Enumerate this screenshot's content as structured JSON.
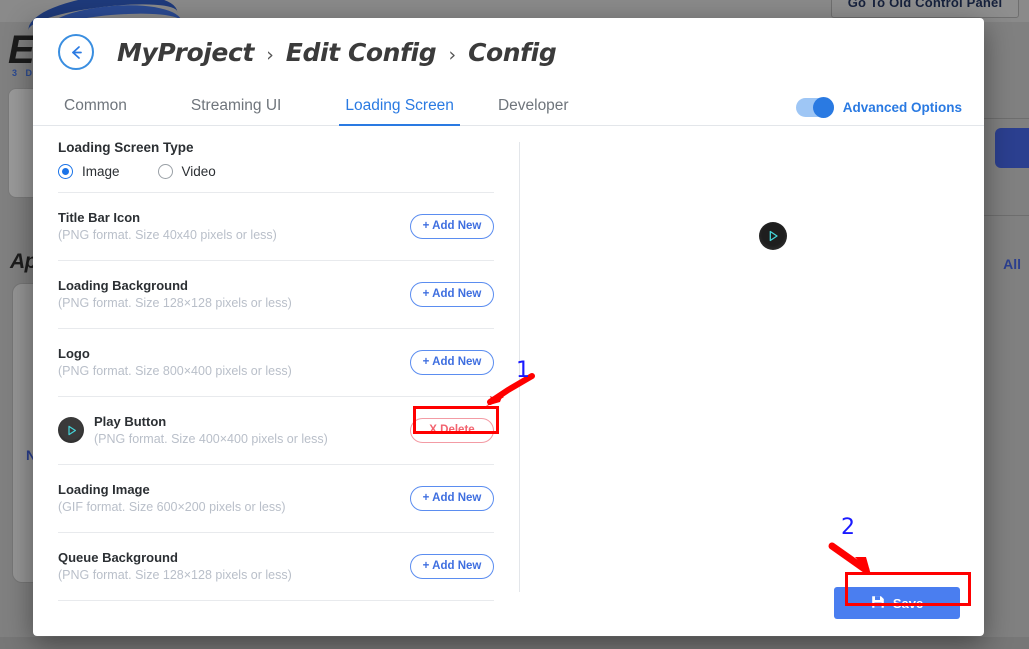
{
  "background": {
    "old_control_panel_button": "Go To Old Control Panel",
    "logo_text": "E",
    "logo_subtext": "3 D",
    "apps_label": "Ap",
    "n_label": "N",
    "all_link": "All"
  },
  "modal": {
    "back_icon": "arrow-left-icon",
    "breadcrumb": {
      "items": [
        "MyProject",
        "Edit Config",
        "Config"
      ],
      "separator": "›"
    },
    "tabs": [
      {
        "label": "Common",
        "active": false
      },
      {
        "label": "Streaming UI",
        "active": false
      },
      {
        "label": "Loading Screen",
        "active": true
      },
      {
        "label": "Developer",
        "active": false
      }
    ],
    "advanced_options": {
      "label": "Advanced Options",
      "enabled": true
    },
    "loading_screen_type": {
      "title": "Loading Screen Type",
      "options": [
        {
          "label": "Image",
          "selected": true
        },
        {
          "label": "Video",
          "selected": false
        }
      ]
    },
    "assets": [
      {
        "name": "Title Bar Icon",
        "hint": "(PNG format. Size 40x40 pixels or less)",
        "action": "+ Add New",
        "action_type": "add",
        "has_thumb": false
      },
      {
        "name": "Loading Background",
        "hint": "(PNG format. Size 128×128 pixels or less)",
        "action": "+ Add New",
        "action_type": "add",
        "has_thumb": false
      },
      {
        "name": "Logo",
        "hint": "(PNG format. Size 800×400 pixels or less)",
        "action": "+ Add New",
        "action_type": "add",
        "has_thumb": false
      },
      {
        "name": "Play Button",
        "hint": "(PNG format. Size 400×400 pixels or less)",
        "action": "X Delete",
        "action_type": "delete",
        "has_thumb": true,
        "thumb_icon": "play-circle-icon"
      },
      {
        "name": "Loading Image",
        "hint": "(GIF format. Size 600×200 pixels or less)",
        "action": "+ Add New",
        "action_type": "add",
        "has_thumb": false
      },
      {
        "name": "Queue Background",
        "hint": "(PNG format. Size 128×128 pixels or less)",
        "action": "+ Add New",
        "action_type": "add",
        "has_thumb": false
      }
    ],
    "preview": {
      "icon": "play-circle-icon"
    },
    "save_button": {
      "label": "Save",
      "icon": "save-disk-icon"
    }
  },
  "annotations": [
    {
      "number": "1",
      "target": "delete-button"
    },
    {
      "number": "2",
      "target": "save-button"
    }
  ],
  "colors": {
    "accent_blue": "#2a7ae2",
    "save_blue": "#4a7ef0",
    "delete_red": "#f2636f",
    "annotation_red": "#ff0000",
    "annotation_number_blue": "#1a1aff",
    "play_icon_cyan": "#45d4d8"
  }
}
